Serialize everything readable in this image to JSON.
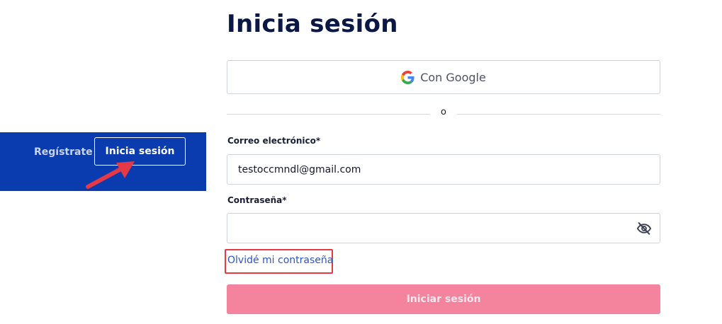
{
  "page": {
    "title": "Inicia sesión"
  },
  "nav": {
    "register_label": "Regístrate",
    "login_label": "Inicia sesión"
  },
  "social": {
    "google_label": "Con Google"
  },
  "divider": {
    "text": "o"
  },
  "form": {
    "email_label": "Correo electrónico*",
    "email_value": "testoccmndl@gmail.com",
    "password_label": "Contraseña*",
    "password_value": "",
    "forgot_label": "Olvidé mi contraseña",
    "submit_label": "Iniciar sesión"
  },
  "colors": {
    "nav_background": "#0a3cb0",
    "title_text": "#0b1846",
    "link": "#2a55c8",
    "submit_background": "#f4839e",
    "annotation_red": "#e63946"
  },
  "icons": {
    "google": "google-g-icon",
    "password_toggle": "eye-slash-icon",
    "annotation": "red-arrow-icon"
  }
}
